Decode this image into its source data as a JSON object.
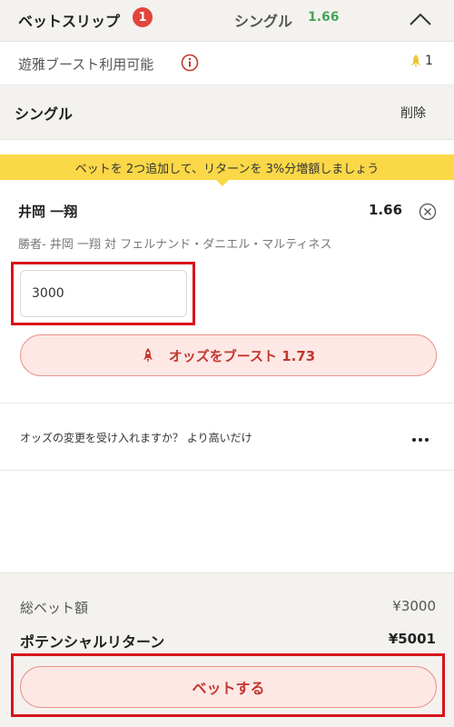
{
  "header": {
    "title": "ベットスリップ",
    "badge_count": "1",
    "bet_type": "シングル",
    "total_odds": "1.66",
    "collapse_icon": "chevron-up-icon"
  },
  "boost_availability": {
    "label": "遊雅ブースト利用可能",
    "info_icon": "info-icon",
    "rocket_icon": "rocket-icon",
    "count": "1"
  },
  "section": {
    "title": "シングル",
    "delete_label": "削除"
  },
  "promo": {
    "text": "ベットを 2つ追加して、リターンを 3%分増額しましょう"
  },
  "selection": {
    "name": "井岡 一翔",
    "odds": "1.66",
    "market": "勝者- 井岡 一翔 対 フェルナンド・ダニエル・マルティネス",
    "stake_value": "3000",
    "boost_button_label": "オッズをブースト 1.73",
    "close_icon": "close-circle-icon"
  },
  "odds_change": {
    "label": "オッズの変更を受け入れますか？ より高いだけ",
    "menu_icon": "more-dots-icon"
  },
  "summary": {
    "total_stake_label": "総ベット額",
    "total_stake_value": "¥3000",
    "potential_return_label": "ポテンシャルリターン",
    "potential_return_value": "¥5001",
    "place_bet_label": "ベットする"
  },
  "colors": {
    "accent_red": "#c4372e",
    "highlight_red": "#d8141a",
    "promo_yellow": "#fbd848",
    "odds_green": "#4aa35a",
    "panel_bg": "#f4f2ef"
  }
}
